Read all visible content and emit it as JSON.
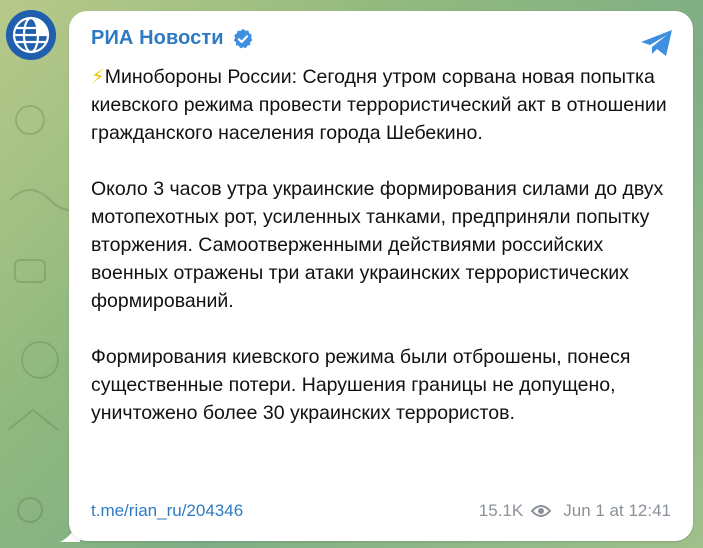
{
  "channel": {
    "name": "РИА Новости",
    "verified_icon": "verified-badge-icon",
    "avatar_icon": "ria-globe-logo-icon",
    "share_icon": "telegram-share-icon"
  },
  "message": {
    "paragraph1_icon": "lightning-icon",
    "paragraph1": "Минобороны России: Сегодня утром сорвана новая попытка киевского режима провести террористический акт в отношении гражданского населения города Шебекино.",
    "paragraph2": "Около 3 часов утра украинские формирования силами до двух мотопехотных рот, усиленных танками, предприняли попытку вторжения. Самоотверженными действиями российских военных отражены три атаки украинских террористических формирований.",
    "paragraph3": "Формирования киевского режима были отброшены, понеся существенные потери. Нарушения границы не допущено, уничтожено более 30 украинских террористов."
  },
  "footer": {
    "link": "t.me/rian_ru/204346",
    "views": "15.1K",
    "views_icon": "eye-icon",
    "timestamp": "Jun 1 at 12:41"
  },
  "colors": {
    "accent": "#2e7bc4",
    "meta": "#8a9199",
    "lightning": "#f2c200",
    "avatar_bg": "#1f5fae"
  }
}
